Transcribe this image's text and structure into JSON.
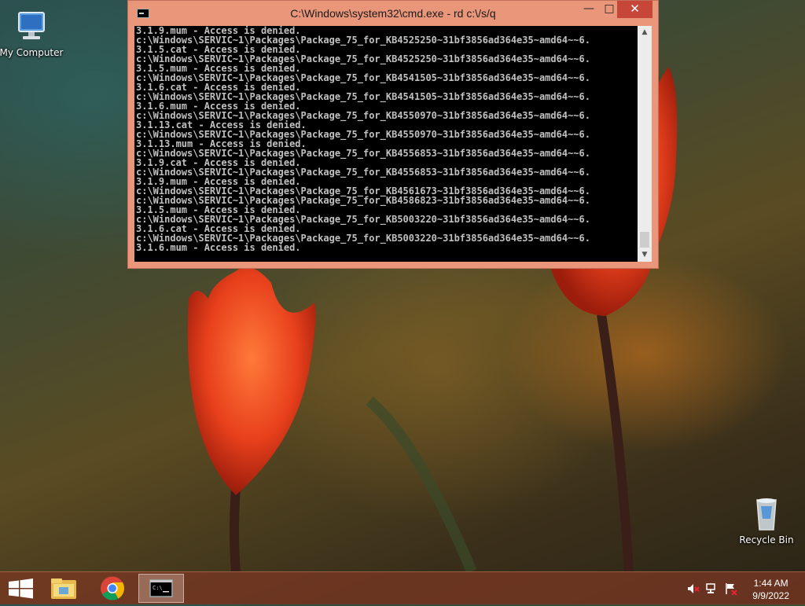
{
  "desktop": {
    "icons": [
      {
        "label": "My Computer",
        "icon": "computer-icon"
      },
      {
        "label": "Recycle Bin",
        "icon": "recycle-bin-icon"
      }
    ]
  },
  "cmd_window": {
    "title": "C:\\Windows\\system32\\cmd.exe - rd  c:\\/s/q",
    "minimize": "—",
    "maximize": "□",
    "close": "✕",
    "lines": [
      "3.1.9.mum - Access is denied.",
      "c:\\Windows\\SERVIC~1\\Packages\\Package_75_for_KB4525250~31bf3856ad364e35~amd64~~6.",
      "3.1.5.cat - Access is denied.",
      "c:\\Windows\\SERVIC~1\\Packages\\Package_75_for_KB4525250~31bf3856ad364e35~amd64~~6.",
      "3.1.5.mum - Access is denied.",
      "c:\\Windows\\SERVIC~1\\Packages\\Package_75_for_KB4541505~31bf3856ad364e35~amd64~~6.",
      "3.1.6.cat - Access is denied.",
      "c:\\Windows\\SERVIC~1\\Packages\\Package_75_for_KB4541505~31bf3856ad364e35~amd64~~6.",
      "3.1.6.mum - Access is denied.",
      "c:\\Windows\\SERVIC~1\\Packages\\Package_75_for_KB4550970~31bf3856ad364e35~amd64~~6.",
      "3.1.13.cat - Access is denied.",
      "c:\\Windows\\SERVIC~1\\Packages\\Package_75_for_KB4550970~31bf3856ad364e35~amd64~~6.",
      "3.1.13.mum - Access is denied.",
      "c:\\Windows\\SERVIC~1\\Packages\\Package_75_for_KB4556853~31bf3856ad364e35~amd64~~6.",
      "3.1.9.cat - Access is denied.",
      "c:\\Windows\\SERVIC~1\\Packages\\Package_75_for_KB4556853~31bf3856ad364e35~amd64~~6.",
      "3.1.9.mum - Access is denied.",
      "c:\\Windows\\SERVIC~1\\Packages\\Package_75_for_KB4561673~31bf3856ad364e35~amd64~~6.",
      "c:\\Windows\\SERVIC~1\\Packages\\Package_75_for_KB4586823~31bf3856ad364e35~amd64~~6.",
      "3.1.5.mum - Access is denied.",
      "c:\\Windows\\SERVIC~1\\Packages\\Package_75_for_KB5003220~31bf3856ad364e35~amd64~~6.",
      "3.1.6.cat - Access is denied.",
      "c:\\Windows\\SERVIC~1\\Packages\\Package_75_for_KB5003220~31bf3856ad364e35~amd64~~6.",
      "3.1.6.mum - Access is denied."
    ]
  },
  "taskbar": {
    "start_icon": "windows-start-icon",
    "pinned": [
      {
        "name": "file-explorer",
        "icon": "folder-icon"
      },
      {
        "name": "chrome",
        "icon": "chrome-icon"
      },
      {
        "name": "command-prompt",
        "icon": "cmd-icon",
        "active": true
      }
    ],
    "tray": [
      "speaker-muted-icon",
      "network-icon",
      "action-center-flag-icon"
    ],
    "time": "1:44 AM",
    "date": "9/9/2022"
  },
  "colors": {
    "cmd_frame": "#e9967a",
    "close_button": "#c7463a",
    "console_bg": "#000000",
    "console_text": "#c0c0c0",
    "taskbar": "#78371f"
  }
}
